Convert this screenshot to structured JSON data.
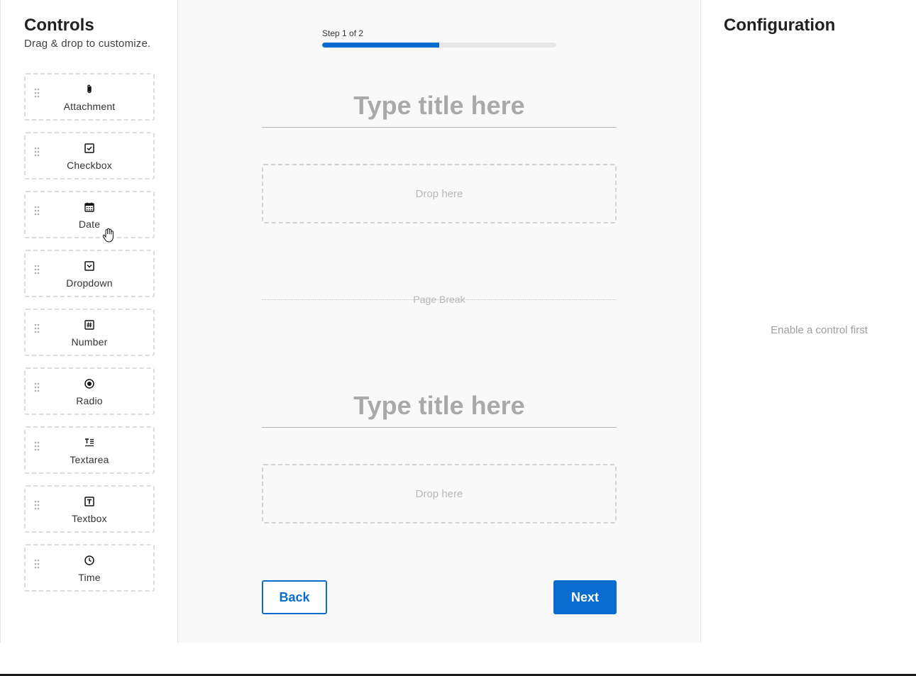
{
  "sidebar": {
    "title": "Controls",
    "subtitle": "Drag & drop to customize.",
    "controls": [
      {
        "label": "Attachment",
        "icon": "paperclip-icon"
      },
      {
        "label": "Checkbox",
        "icon": "checkbox-icon"
      },
      {
        "label": "Date",
        "icon": "calendar-icon"
      },
      {
        "label": "Dropdown",
        "icon": "dropdown-icon"
      },
      {
        "label": "Number",
        "icon": "hash-icon"
      },
      {
        "label": "Radio",
        "icon": "radio-icon"
      },
      {
        "label": "Textarea",
        "icon": "textarea-icon"
      },
      {
        "label": "Textbox",
        "icon": "textbox-icon"
      },
      {
        "label": "Time",
        "icon": "clock-icon"
      }
    ]
  },
  "canvas": {
    "step_label": "Step 1 of 2",
    "progress_fraction": 0.5,
    "sections": [
      {
        "title_placeholder": "Type title here",
        "drop_label": "Drop here"
      },
      {
        "title_placeholder": "Type title here",
        "drop_label": "Drop here"
      }
    ],
    "page_break_label": "Page Break",
    "back_label": "Back",
    "next_label": "Next"
  },
  "config": {
    "title": "Configuration",
    "empty_message": "Enable a control first"
  },
  "colors": {
    "accent": "#0a6ccf",
    "placeholder": "#a9a9a9",
    "canvas_bg": "#f9f9f9"
  }
}
